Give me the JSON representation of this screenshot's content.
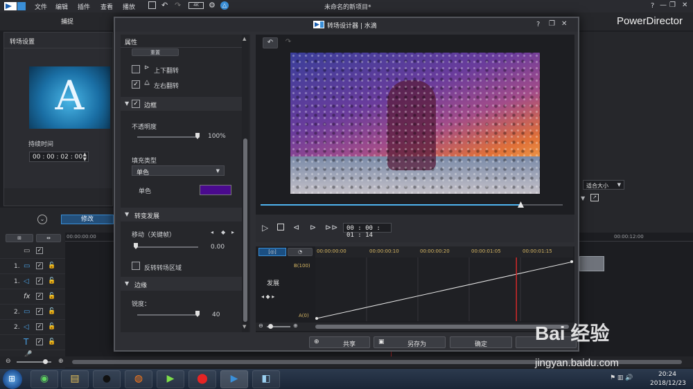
{
  "menubar": {
    "items": [
      "文件",
      "编辑",
      "插件",
      "查看",
      "播放"
    ],
    "title": "未命名的新项目*",
    "window_controls": [
      "?",
      "—",
      "❐",
      "✕"
    ]
  },
  "tabbar": {
    "capture": "捕捉",
    "brand": "PowerDirector"
  },
  "left_panel": {
    "title": "转场设置",
    "thumb_letter": "A",
    "duration_label": "持续时间",
    "duration_value": "00 : 00 : 02 : 00"
  },
  "timeline": {
    "modify_label": "修改",
    "ruler_start": "00:00:00:00",
    "ruler_right": "00:00:12:00",
    "tracks": [
      {
        "num": "",
        "icon": "video-toggle-icon"
      },
      {
        "num": "1.",
        "icon": "video-track-icon"
      },
      {
        "num": "1.",
        "icon": "audio-track-icon"
      },
      {
        "num": "",
        "icon": "fx-track-icon",
        "glyph": "fx"
      },
      {
        "num": "2.",
        "icon": "video-track-icon"
      },
      {
        "num": "2.",
        "icon": "audio-track-icon"
      },
      {
        "num": "",
        "icon": "title-track-icon",
        "glyph": "T"
      },
      {
        "num": "",
        "icon": "voice-track-icon"
      }
    ]
  },
  "right_panel": {
    "fit_size": "适合大小"
  },
  "modal": {
    "title": "转场设计器 | 水滴",
    "controls": [
      "?",
      "❐",
      "✕"
    ],
    "properties": {
      "header": "属性",
      "reset": "重置",
      "flip_v": "上下翻转",
      "flip_h": "左右翻转",
      "border_section": "边框",
      "opacity_label": "不透明度",
      "opacity_value": "100%",
      "fill_type_label": "填充类型",
      "fill_type_value": "单色",
      "solid_label": "单色",
      "solid_color": "#4a0a8e",
      "gradient_section": "转变发展",
      "move_label": "移动（关键帧）",
      "move_value": "0.00",
      "reverse_label": "反转转场区域",
      "edge_section": "边缘",
      "sharpness_label": "锐度：",
      "sharpness_value": "40"
    },
    "player": {
      "timecode": "00 : 00 : 01 : 14",
      "progress": 0.86
    },
    "graph": {
      "ruler": [
        "00:00:00:00",
        "00:00:00:10",
        "00:00:00:20",
        "00:00:01:05",
        "00:00:01:15"
      ],
      "y_top": "B(100)",
      "y_bottom": "A(0)",
      "develop_label": "发展",
      "playhead_ratio": 0.78
    },
    "buttons": {
      "share": "共享",
      "save_as": "另存为",
      "ok": "确定"
    }
  },
  "watermark": {
    "logo_text": "Bai 经验",
    "url": "jingyan.baidu.com"
  },
  "taskbar": {
    "time": "20:24",
    "date": "2018/12/23"
  },
  "colors": {
    "accent": "#3a8fd8",
    "progress": "#4fb3f0",
    "graph_line": "#e6e6e6",
    "playhead": "#d42a2a"
  }
}
